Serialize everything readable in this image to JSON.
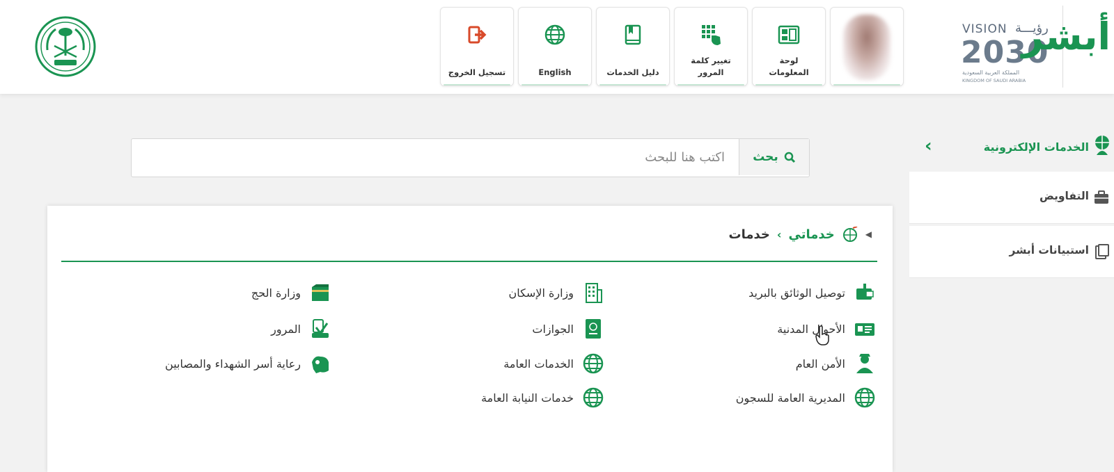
{
  "header": {
    "tiles": [
      {
        "id": "logout",
        "label": "تسجيل الخروج",
        "icon": "logout-icon"
      },
      {
        "id": "english",
        "label": "English",
        "icon": "globe-icon"
      },
      {
        "id": "services-guide",
        "label": "دليل الخدمات",
        "icon": "book-icon"
      },
      {
        "id": "change-password",
        "label": "تغيير كلمة المرور",
        "icon": "keypad-icon"
      },
      {
        "id": "dashboard",
        "label": "لوحة المعلومات",
        "icon": "dashboard-icon"
      }
    ],
    "vision": {
      "top_en": "VISION",
      "top_ar": "رؤيـــة",
      "year": "2030",
      "sub_ar": "المملكة العربية السعودية",
      "sub_en": "KINGDOM OF SAUDI ARABIA"
    },
    "absher_logo": "أبشر"
  },
  "sidebar": {
    "title": "الخدمات الإلكترونية",
    "items": [
      {
        "label": "التفاويض",
        "icon": "briefcase-icon"
      },
      {
        "label": "استبيانات أبشر",
        "icon": "clipboard-icon"
      }
    ]
  },
  "search": {
    "button": "بحث",
    "placeholder": "اكتب هنا للبحث"
  },
  "breadcrumb": {
    "link": "خدماتي",
    "current": "خدمات"
  },
  "services": {
    "col1": [
      {
        "label": "توصيل الوثائق بالبريد",
        "icon": "mailbox-icon"
      },
      {
        "label": "الأحوال المدنية",
        "icon": "id-card-icon"
      },
      {
        "label": "الأمن العام",
        "icon": "officer-icon"
      },
      {
        "label": "المديرية العامة للسجون",
        "icon": "globe-icon"
      }
    ],
    "col2": [
      {
        "label": "وزارة الإسكان",
        "icon": "building-icon"
      },
      {
        "label": "الجوازات",
        "icon": "passport-icon"
      },
      {
        "label": "الخدمات العامة",
        "icon": "globe-icon"
      },
      {
        "label": "خدمات النيابة العامة",
        "icon": "globe-icon"
      }
    ],
    "col3": [
      {
        "label": "وزارة الحج",
        "icon": "kaaba-icon"
      },
      {
        "label": "المرور",
        "icon": "traffic-icon"
      },
      {
        "label": "رعاية أسر الشهداء والمصابين",
        "icon": "family-care-icon"
      }
    ]
  },
  "colors": {
    "brand": "#1a9452",
    "text": "#333333",
    "background": "#f2f2f2"
  }
}
